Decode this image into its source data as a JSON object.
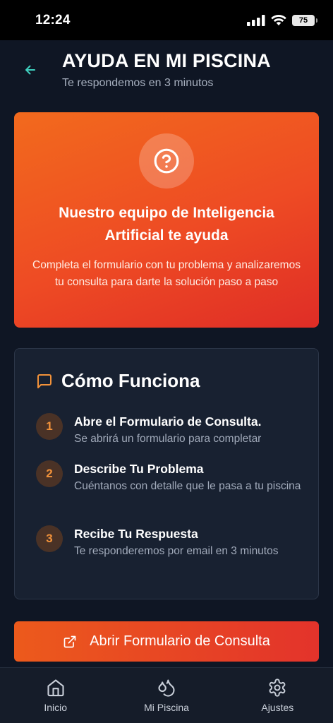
{
  "status_bar": {
    "time": "12:24",
    "battery": "75"
  },
  "header": {
    "title": "AYUDA EN MI PISCINA",
    "subtitle": "Te respondemos en 3 minutos",
    "back_icon": "arrow-left-icon"
  },
  "hero": {
    "icon": "question-circle-icon",
    "title": "Nuestro equipo de Inteligencia Artificial te ayuda",
    "text": "Completa el formulario con tu problema y analizaremos tu consulta para darte la solución paso a paso"
  },
  "how_it_works": {
    "icon": "message-square-icon",
    "title": "Cómo Funciona",
    "steps": [
      {
        "number": "1",
        "title": "Abre el Formulario de Consulta.",
        "description": "Se abrirá un formulario para completar"
      },
      {
        "number": "2",
        "title": "Describe Tu Problema",
        "description": "Cuéntanos con detalle que le pasa a tu piscina"
      },
      {
        "number": "3",
        "title": "Recibe Tu Respuesta",
        "description": "Te responderemos por email en 3 minutos"
      }
    ]
  },
  "cta": {
    "icon": "external-link-icon",
    "label": "Abrir Formulario de Consulta"
  },
  "tab_bar": {
    "items": [
      {
        "label": "Inicio",
        "icon": "home-icon"
      },
      {
        "label": "Mi Piscina",
        "icon": "droplets-icon"
      },
      {
        "label": "Ajustes",
        "icon": "gear-icon"
      }
    ]
  },
  "colors": {
    "background": "#0f1624",
    "accent_orange": "#f26a1d",
    "accent_red": "#df2d26",
    "back_arrow": "#3fd1c0",
    "card": "#182131"
  }
}
